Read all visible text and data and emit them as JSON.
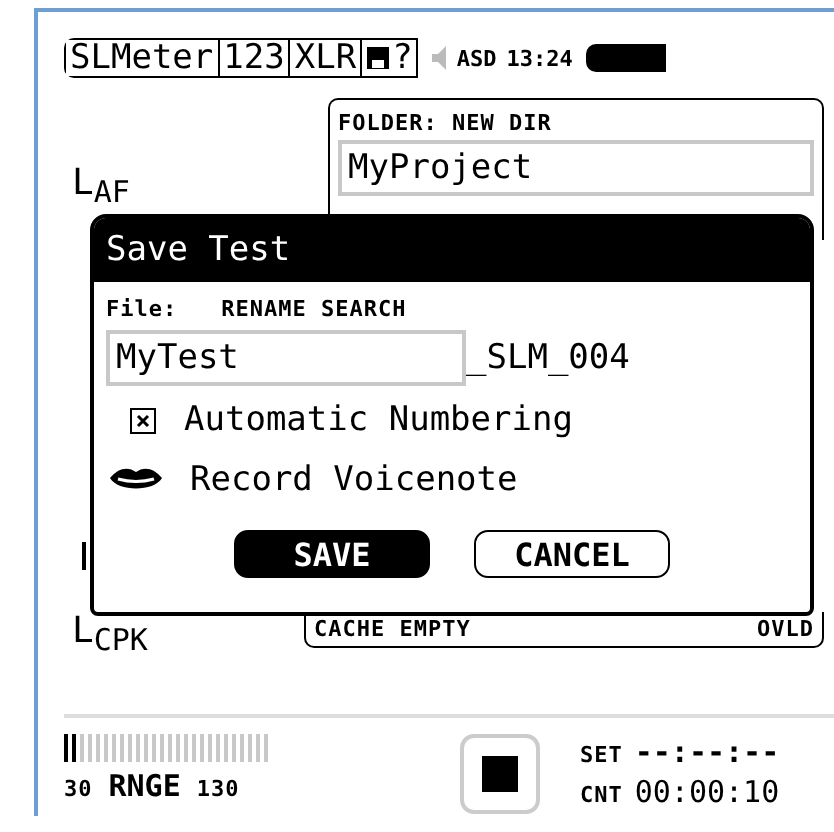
{
  "top_bar": {
    "tabs": [
      "SLMeter",
      "123",
      "XLR"
    ],
    "help": "?",
    "status": "ASD",
    "time": "13:24"
  },
  "folder_panel": {
    "title": "FOLDER: NEW DIR",
    "value": "MyProject"
  },
  "side_labels": [
    {
      "main": "L",
      "sub": "AF"
    },
    {
      "main": "L",
      "sub": "CPK"
    }
  ],
  "dialog": {
    "title": "Save Test",
    "file_label": "File:",
    "actions_label": "RENAME SEARCH",
    "file_name": "MyTest",
    "suffix": "_SLM_004",
    "auto_numbering": {
      "label": "Automatic Numbering",
      "checked": true
    },
    "voicenote": {
      "label": "Record Voicenote"
    },
    "buttons": [
      {
        "label": "SAVE",
        "selected": true
      },
      {
        "label": "CANCEL",
        "selected": false
      }
    ]
  },
  "cache_panel": {
    "status": "CACHE EMPTY",
    "overload": "OVLD"
  },
  "meter": {
    "level": 0.08,
    "low": "30",
    "label": "RNGE",
    "high": "130"
  },
  "timer": {
    "set_label": "SET",
    "set_value": "--:--:--",
    "count_label": "CNT",
    "count_value": "00:00:10"
  }
}
